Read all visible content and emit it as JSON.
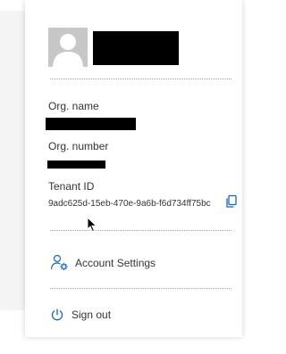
{
  "org": {
    "name_label": "Org. name",
    "number_label": "Org. number"
  },
  "tenant": {
    "label": "Tenant ID",
    "id": "9adc625d-15eb-470e-9a6b-f6d734ff75bc",
    "copy_icon": "copy-icon"
  },
  "menu": {
    "account_settings": "Account Settings",
    "account_settings_icon": "user-gear-icon",
    "sign_out": "Sign out",
    "sign_out_icon": "power-icon"
  },
  "colors": {
    "accent": "#1565c0",
    "separator": "#9aa3b0",
    "avatar": "#c7c7c7",
    "redaction": "#000000"
  }
}
